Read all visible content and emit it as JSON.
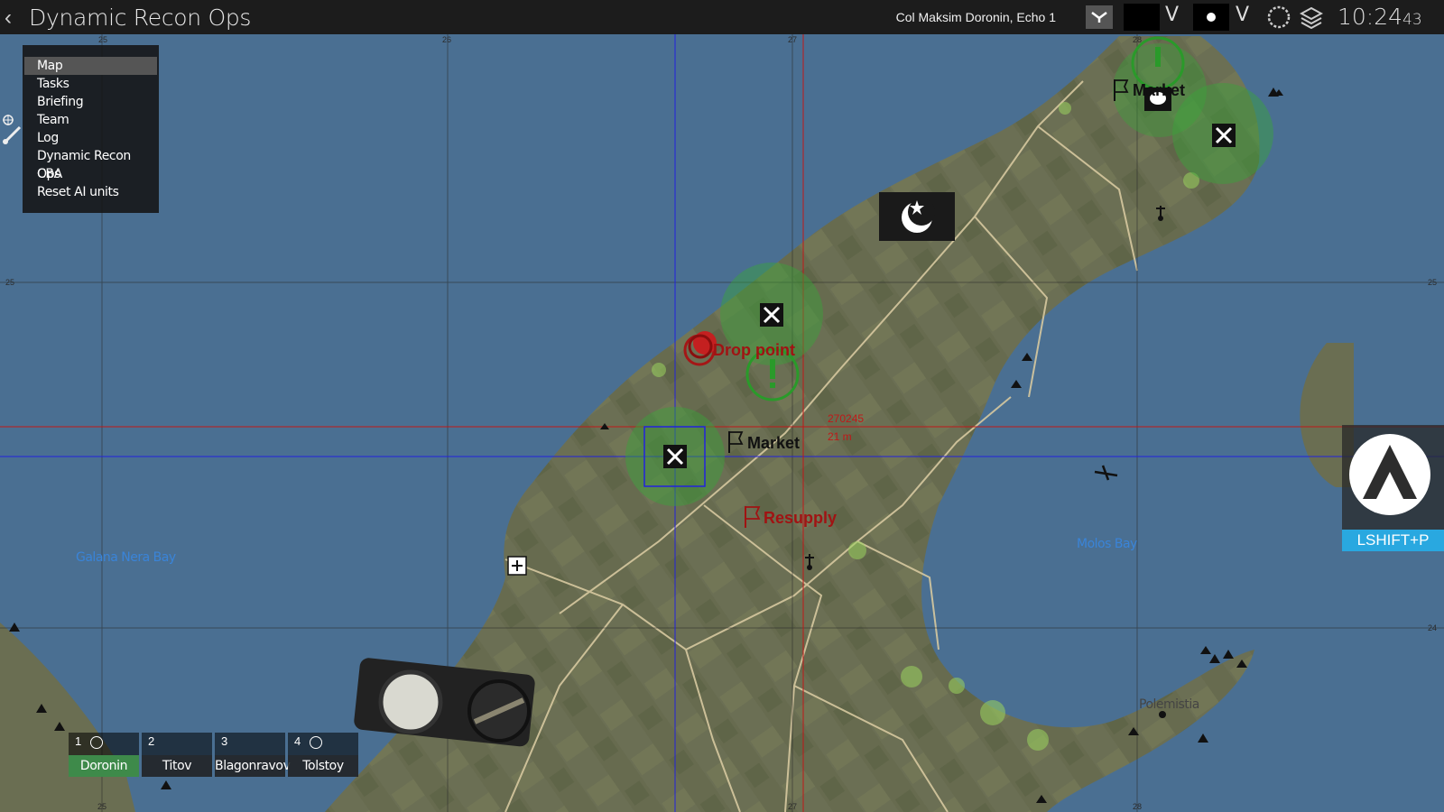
{
  "app": {
    "title": "Dynamic Recon Ops",
    "player": "Col Maksim Doronin, Echo 1",
    "clock_hm": "10:24",
    "clock_s": "43"
  },
  "menu": {
    "items": [
      {
        "label": "Map"
      },
      {
        "label": "Tasks"
      },
      {
        "label": "Briefing"
      },
      {
        "label": "Team"
      },
      {
        "label": "Log"
      },
      {
        "label": "Dynamic Recon Ops"
      },
      {
        "label": "CBA"
      },
      {
        "label": "Reset AI units"
      }
    ],
    "active": "Map"
  },
  "grid": {
    "top_labels": [
      "25",
      "26",
      "27",
      "28"
    ],
    "side_labels": [
      "25",
      "24"
    ],
    "bottom_labels": [
      "25",
      "27",
      "28"
    ]
  },
  "markers": {
    "drop_point": "Drop point",
    "market_1": "Market",
    "market_2": "Market",
    "resupply": "Resupply",
    "coords": "270245",
    "distance": "21 m"
  },
  "places": {
    "galana": "Galana Nera Bay",
    "molos": "Molos Bay",
    "polemistia": "Polemistia"
  },
  "shortcut": {
    "label": "LSHIFT+P"
  },
  "team": [
    {
      "num": "1",
      "name": "Doronin"
    },
    {
      "num": "2",
      "name": "Titov"
    },
    {
      "num": "3",
      "name": "Blagonravov"
    },
    {
      "num": "4",
      "name": "Tolstoy"
    }
  ],
  "colors": {
    "water": "#4a6f92",
    "land": "#6a6e52",
    "objective": "#2e9a33",
    "enemy_marker": "#9e1111",
    "accent": "#29a8e0"
  }
}
